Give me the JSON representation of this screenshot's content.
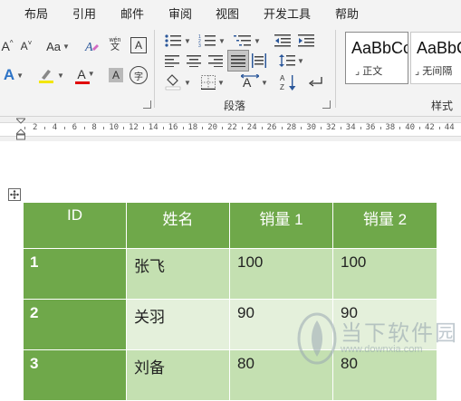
{
  "menu": {
    "items": [
      "布局",
      "引用",
      "邮件",
      "审阅",
      "视图",
      "开发工具",
      "帮助"
    ]
  },
  "ribbon": {
    "font_group": {
      "grow_font": "A^",
      "shrink_font": "A˅",
      "change_case": "Aa",
      "phonetic_guide_top": "wén",
      "phonetic_guide_bottom": "文",
      "char_border": "A",
      "text_effects": "A",
      "font_color": "A",
      "char_shading": "A",
      "enclose_char": "字",
      "highlight_color": "#f2e600",
      "font_color_bar": "#e00000"
    },
    "paragraph_group": {
      "label": "段落"
    },
    "styles_group": {
      "label": "样式",
      "cards": [
        {
          "sample": "AaBbCc",
          "name": "正文"
        },
        {
          "sample": "AaBbCc",
          "name": "无间隔"
        }
      ]
    }
  },
  "ruler": {
    "numbers": [
      "2",
      "4",
      "6",
      "8",
      "10",
      "12",
      "14",
      "16",
      "18",
      "20",
      "22",
      "24",
      "26",
      "28",
      "30",
      "32",
      "34",
      "36",
      "38",
      "40",
      "42",
      "44"
    ]
  },
  "table": {
    "headers": [
      "ID",
      "姓名",
      "销量 1",
      "销量 2"
    ],
    "rows": [
      {
        "id": "1",
        "name": "张飞",
        "sales1": "100",
        "sales2": "100"
      },
      {
        "id": "2",
        "name": "关羽",
        "sales1": "90",
        "sales2": "90"
      },
      {
        "id": "3",
        "name": "刘备",
        "sales1": "80",
        "sales2": "80"
      }
    ],
    "header_color": "#6fa84a",
    "band_dark": "#c4e0b1",
    "band_light": "#e4f0db"
  },
  "watermark": {
    "name": "当下软件园",
    "url": "www.downxia.com"
  }
}
